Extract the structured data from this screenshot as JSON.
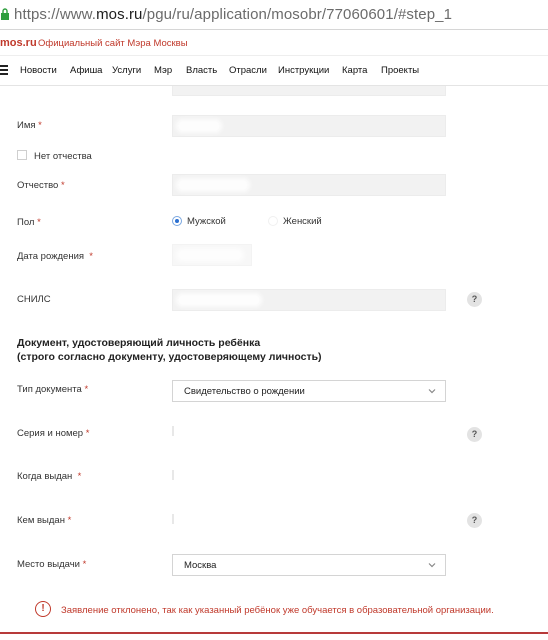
{
  "browser": {
    "url_prefix": "https://www.",
    "url_domain": "mos.ru",
    "url_path": "/pgu/ru/application/mosobr/77060601/#step_1"
  },
  "site": {
    "logo": "mos.ru",
    "tagline": "Официальный сайт Мэра Москвы"
  },
  "nav": {
    "items": [
      "Новости",
      "Афиша",
      "Услуги",
      "Мэр",
      "Власть",
      "Отрасли",
      "Инструкции",
      "Карта",
      "Проекты"
    ]
  },
  "form": {
    "name_label": "Имя",
    "no_patronymic_label": "Нет отчества",
    "patronymic_label": "Отчество",
    "gender_label": "Пол",
    "gender_male": "Мужской",
    "gender_female": "Женский",
    "birthdate_label": "Дата рождения",
    "snils_label": "СНИЛС",
    "required_mark": "*",
    "help_glyph": "?",
    "doc_section_title_line1": "Документ, удостоверяющий личность ребёнка",
    "doc_section_title_line2": "(строго согласно документу, удостоверяющему личность)",
    "doc_type_label": "Тип документа",
    "doc_type_value": "Свидетельство о рождении",
    "series_number_label": "Серия и номер",
    "issued_when_label": "Когда выдан",
    "issued_by_label": "Кем выдан",
    "issue_place_label": "Место выдачи",
    "issue_place_value": "Москва"
  },
  "alert": {
    "icon_glyph": "!",
    "message": "Заявление отклонено, так как указанный ребёнок уже обучается в образовательной организации."
  },
  "colors": {
    "accent_red": "#c0392b",
    "radio_blue": "#2b6fd1",
    "field_bg": "#f2f2f2"
  }
}
